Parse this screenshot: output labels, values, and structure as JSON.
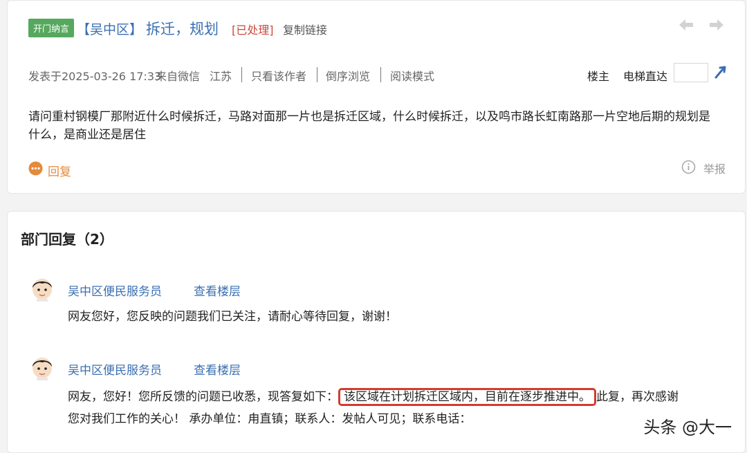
{
  "post": {
    "badge": "开门纳言",
    "district": "【吴中区】",
    "title": "拆迁，规划",
    "status": "[已处理]",
    "copy_link": "复制链接",
    "meta": {
      "posted": "发表于2025-03-26 17:33",
      "source": "来自微信",
      "location": "江苏",
      "only_author": "只看该作者",
      "reverse_browse": "倒序浏览",
      "read_mode": "阅读模式"
    },
    "landlord": "楼主",
    "elevator": "电梯直达",
    "floor_input_value": "",
    "body": "请问重村钢模厂那附近什么时候拆迁，马路对面那一片也是拆迁区域，什么时候拆迁，以及鸣市路长虹南路那一片空地后期的规划是什么，是商业还是居住",
    "reply_label": "回复",
    "report_label": "举报"
  },
  "replies": {
    "section_title": "部门回复（2）",
    "items": [
      {
        "author": "吴中区便民服务员",
        "view_floor": "查看楼层",
        "text": "网友您好，您反映的问题我们已关注，请耐心等待回复，谢谢！"
      },
      {
        "author": "吴中区便民服务员",
        "view_floor": "查看楼层",
        "text_before": "网友，您好！您所反馈的问题已收悉，现答复如下：",
        "text_highlight": "该区域在计划拆迁区域内，目前在逐步推进中。",
        "text_after": "此复，再次感谢",
        "text_line2": "您对我们工作的关心！ 承办单位：甪直镇；联系人：发帖人可见；联系电话："
      }
    ]
  },
  "watermark": "头条 @大一",
  "colors": {
    "link_blue": "#3b6fb0",
    "status_red": "#c94a3a",
    "badge_green": "#56a85e",
    "reply_orange": "#e38a3c",
    "highlight_red": "#d23b2e"
  }
}
